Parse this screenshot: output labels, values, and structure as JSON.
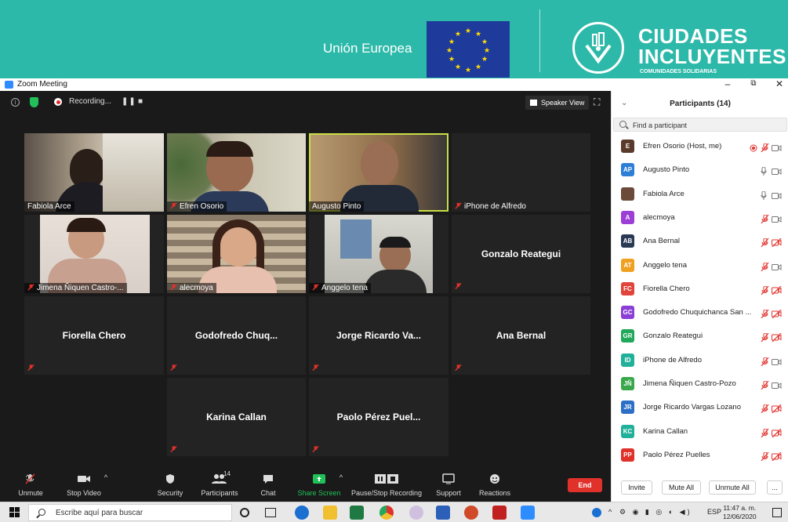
{
  "banner": {
    "eu_text": "Unión Europea",
    "logo_line1": "CIUDADES",
    "logo_line2": "INCLUYENTES",
    "logo_sub": "COMUNIDADES SOLIDARIAS",
    "color": "#2db9a9"
  },
  "window": {
    "title": "Zoom Meeting",
    "minimize": "–",
    "restore": "⧉",
    "close": "✕"
  },
  "meeting": {
    "recording_label": "Recording...",
    "speaker_view_label": "Speaker View",
    "tiles": [
      {
        "name": "Fabiola Arce",
        "video": true
      },
      {
        "name": "Efren Osorio",
        "video": true
      },
      {
        "name": "Augusto Pinto",
        "video": true,
        "active": true
      },
      {
        "name": "iPhone de Alfredo",
        "video": false,
        "label_only": true
      },
      {
        "name": "Jimena Ñiquen Castro-...",
        "video": true
      },
      {
        "name": "alecmoya",
        "video": true
      },
      {
        "name": "Anggelo tena",
        "video": true
      },
      {
        "name": "Gonzalo Reategui",
        "video": false
      },
      {
        "name": "Fiorella Chero",
        "video": false
      },
      {
        "name": "Godofredo  Chuq...",
        "video": false
      },
      {
        "name": "Jorge Ricardo  Va...",
        "video": false
      },
      {
        "name": "Ana Bernal",
        "video": false
      },
      {
        "name": "Karina Callan",
        "video": false
      },
      {
        "name": "Paolo Pérez Puel...",
        "video": false
      }
    ]
  },
  "toolbar": {
    "unmute": "Unmute",
    "stop_video": "Stop Video",
    "security": "Security",
    "participants": "Participants",
    "participants_count": "14",
    "chat": "Chat",
    "share_screen": "Share Screen",
    "pause_recording": "Pause/Stop Recording",
    "support": "Support",
    "reactions": "Reactions",
    "end": "End",
    "accent_green": "#21c05a",
    "end_red": "#e0312b"
  },
  "panel": {
    "title": "Participants (14)",
    "search_placeholder": "Find a participant",
    "participants": [
      {
        "initials": "E",
        "name": "Efren Osorio (Host, me)",
        "color": "#5a3a2a",
        "mic": "rec",
        "cam": "on"
      },
      {
        "initials": "AP",
        "name": "Augusto Pinto",
        "color": "#2d7fd6",
        "mic": "on",
        "cam": "on"
      },
      {
        "initials": "",
        "name": "Fabiola Arce",
        "color": "#6b4a3a",
        "mic": "on",
        "cam": "on",
        "photo": true
      },
      {
        "initials": "A",
        "name": "alecmoya",
        "color": "#9b3fd6",
        "mic": "muted",
        "cam": "on"
      },
      {
        "initials": "AB",
        "name": "Ana Bernal",
        "color": "#2a3a55",
        "mic": "muted",
        "cam": "off"
      },
      {
        "initials": "AT",
        "name": "Anggelo tena",
        "color": "#f0a020",
        "mic": "muted",
        "cam": "on"
      },
      {
        "initials": "FC",
        "name": "Fiorella Chero",
        "color": "#e0443a",
        "mic": "muted",
        "cam": "off"
      },
      {
        "initials": "GC",
        "name": "Godofredo Chuquichanca San ...",
        "color": "#8b3fd6",
        "mic": "muted",
        "cam": "off"
      },
      {
        "initials": "GR",
        "name": "Gonzalo Reategui",
        "color": "#21a85a",
        "mic": "muted",
        "cam": "off"
      },
      {
        "initials": "ID",
        "name": "iPhone de Alfredo",
        "color": "#21b09a",
        "mic": "muted",
        "cam": "on"
      },
      {
        "initials": "JÑ",
        "name": "Jimena Ñiquen Castro-Pozo",
        "color": "#3aa84a",
        "mic": "muted",
        "cam": "on"
      },
      {
        "initials": "JR",
        "name": "Jorge Ricardo Vargas Lozano",
        "color": "#2d6fc6",
        "mic": "muted",
        "cam": "off"
      },
      {
        "initials": "KC",
        "name": "Karina Callan",
        "color": "#21b09a",
        "mic": "muted",
        "cam": "off"
      },
      {
        "initials": "PP",
        "name": "Paolo Pérez Puelles",
        "color": "#e0312b",
        "mic": "muted",
        "cam": "off"
      }
    ],
    "invite": "Invite",
    "mute_all": "Mute All",
    "unmute_all": "Unmute All",
    "more": "..."
  },
  "taskbar": {
    "search_text": "Escribe aquí para buscar",
    "lang": "ESP",
    "time": "11:47 a. m.",
    "date": "12/06/2020"
  }
}
